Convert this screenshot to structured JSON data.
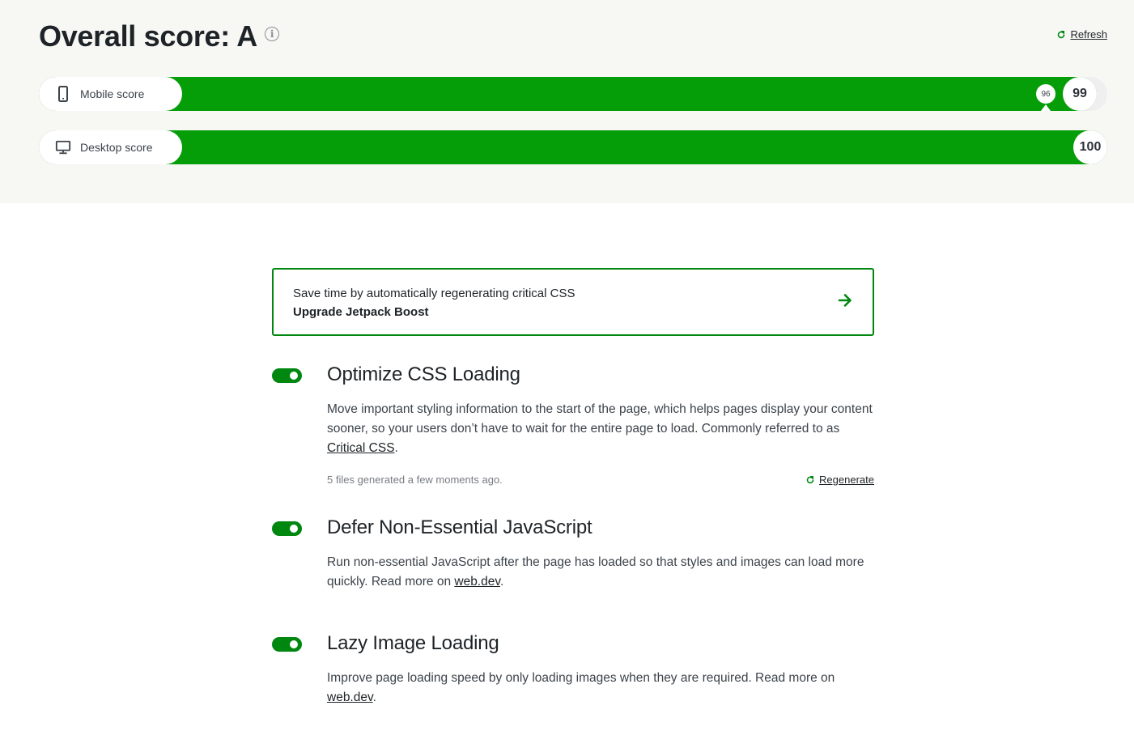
{
  "header": {
    "title": "Overall score: A",
    "info_icon": "info-icon",
    "refresh_label": "Refresh",
    "refresh_icon": "refresh-icon"
  },
  "scores": {
    "mobile": {
      "label": "Mobile score",
      "icon": "mobile-phone-icon",
      "score": "99",
      "previous_score": "96",
      "fill_percent": 99
    },
    "desktop": {
      "label": "Desktop score",
      "icon": "desktop-monitor-icon",
      "score": "100",
      "fill_percent": 100
    }
  },
  "upsell": {
    "line1": "Save time by automatically regenerating critical CSS",
    "line2": "Upgrade Jetpack Boost",
    "icon": "arrow-right-icon"
  },
  "modules": [
    {
      "title": "Optimize CSS Loading",
      "enabled": true,
      "desc_before": "Move important styling information to the start of the page, which helps pages display your content sooner, so your users don’t have to wait for the entire page to load. Commonly referred to as ",
      "link": "Critical CSS",
      "desc_after": ".",
      "meta": "5 files generated a few moments ago.",
      "action_label": "Regenerate"
    },
    {
      "title": "Defer Non-Essential JavaScript",
      "enabled": true,
      "desc_before": "Run non-essential JavaScript after the page has loaded so that styles and images can load more quickly. Read more on ",
      "link": "web.dev",
      "desc_after": "."
    },
    {
      "title": "Lazy Image Loading",
      "enabled": true,
      "desc_before": "Improve page loading speed by only loading images when they are required. Read more on ",
      "link": "web.dev",
      "desc_after": "."
    }
  ],
  "colors": {
    "accent": "#008710",
    "score_bar": "#069e08",
    "top_background": "#f7f7f4"
  }
}
